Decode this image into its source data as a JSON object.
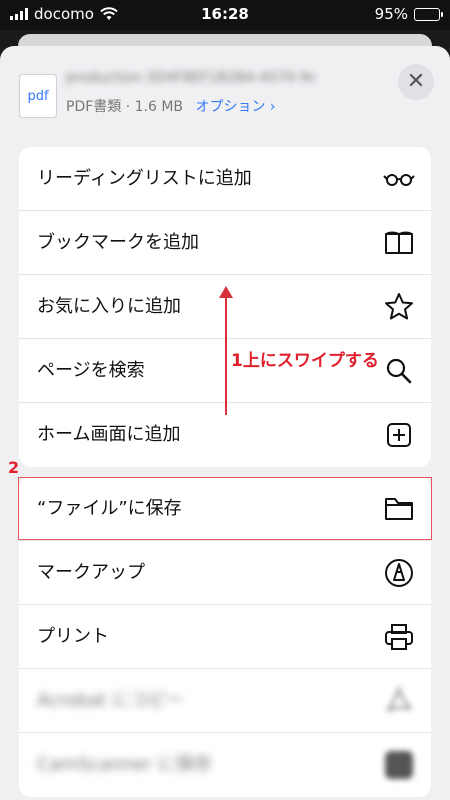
{
  "status_bar": {
    "carrier": "docomo",
    "time": "16:28",
    "battery": "95%",
    "battery_level": 0.95
  },
  "header": {
    "file_icon_text": "pdf",
    "file_name": "production-3D4F8EF1B2B4-4570-9c6a-xxxf",
    "file_meta": "PDF書類 · 1.6 MB",
    "options_label": "オプション ›"
  },
  "group1": [
    {
      "label": "リーディングリストに追加",
      "icon": "reading-glasses-icon"
    },
    {
      "label": "ブックマークを追加",
      "icon": "book-icon"
    },
    {
      "label": "お気に入りに追加",
      "icon": "star-icon"
    },
    {
      "label": "ページを検索",
      "icon": "search-icon"
    },
    {
      "label": "ホーム画面に追加",
      "icon": "add-square-icon"
    }
  ],
  "group2": [
    {
      "label": "“ファイル”に保存",
      "icon": "folder-icon"
    },
    {
      "label": "マークアップ",
      "icon": "markup-pen-icon"
    },
    {
      "label": "プリント",
      "icon": "printer-icon"
    },
    {
      "label": "Acrobat にコピー",
      "icon": "acrobat-icon"
    },
    {
      "label": "CamScanner に保存",
      "icon": "app-icon"
    }
  ],
  "annotations": {
    "step1": "1上にスワイプする",
    "step2": "2"
  },
  "colors": {
    "accent": "#3478f6",
    "annotation": "#e0202c"
  }
}
